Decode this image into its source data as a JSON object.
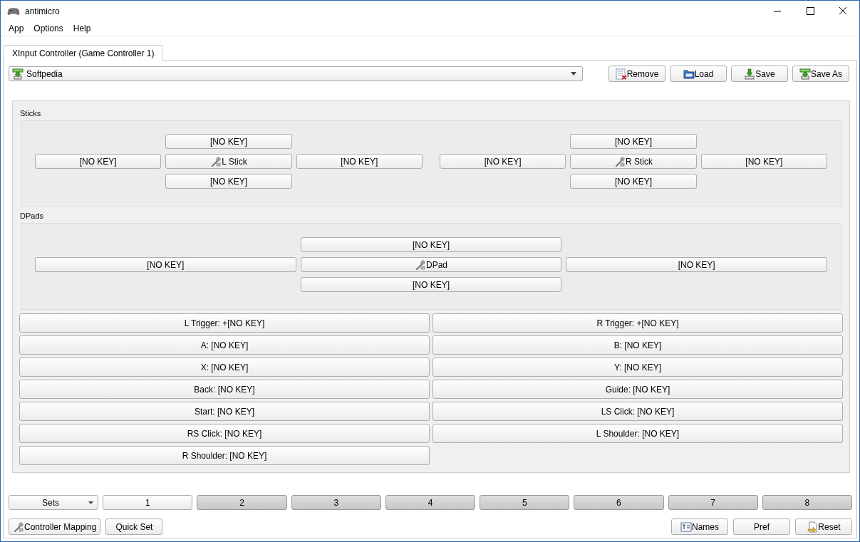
{
  "window": {
    "title": "antimicro"
  },
  "menu": [
    "App",
    "Options",
    "Help"
  ],
  "tabs": [
    {
      "label": "XInput Controller (Game Controller 1)",
      "selected": true
    }
  ],
  "profile": {
    "value": "Softpedia"
  },
  "profile_buttons": [
    {
      "kind": "remove",
      "label": "Remove"
    },
    {
      "kind": "load",
      "label": "Load"
    },
    {
      "kind": "save",
      "label": "Save"
    },
    {
      "kind": "saveas",
      "label": "Save As"
    }
  ],
  "sticks": {
    "label": "Sticks",
    "items": [
      {
        "label": "L Stick",
        "up": "[NO KEY]",
        "left": "[NO KEY]",
        "right": "[NO KEY]",
        "down": "[NO KEY]"
      },
      {
        "label": "R Stick",
        "up": "[NO KEY]",
        "left": "[NO KEY]",
        "right": "[NO KEY]",
        "down": "[NO KEY]"
      }
    ]
  },
  "dpads": {
    "label": "DPads",
    "items": [
      {
        "label": "DPad",
        "up": "[NO KEY]",
        "left": "[NO KEY]",
        "right": "[NO KEY]",
        "down": "[NO KEY]"
      }
    ]
  },
  "buttons": [
    "L Trigger: +[NO KEY]",
    "R Trigger: +[NO KEY]",
    "A: [NO KEY]",
    "B: [NO KEY]",
    "X: [NO KEY]",
    "Y: [NO KEY]",
    "Back: [NO KEY]",
    "Guide: [NO KEY]",
    "Start: [NO KEY]",
    "LS Click: [NO KEY]",
    "RS Click: [NO KEY]",
    "L Shoulder: [NO KEY]",
    "R Shoulder: [NO KEY]"
  ],
  "sets": {
    "label": "Sets",
    "items": [
      {
        "label": "1",
        "selected": true
      },
      {
        "label": "2",
        "selected": false
      },
      {
        "label": "3",
        "selected": false
      },
      {
        "label": "4",
        "selected": false
      },
      {
        "label": "5",
        "selected": false
      },
      {
        "label": "6",
        "selected": false
      },
      {
        "label": "7",
        "selected": false
      },
      {
        "label": "8",
        "selected": false
      }
    ]
  },
  "bottom_left": [
    {
      "kind": "mapping",
      "label": "Controller Mapping"
    },
    {
      "kind": "plain",
      "label": "Quick Set"
    }
  ],
  "bottom_right": [
    {
      "kind": "names",
      "label": "Names"
    },
    {
      "kind": "plain",
      "label": "Pref"
    },
    {
      "kind": "reset",
      "label": "Reset"
    }
  ]
}
